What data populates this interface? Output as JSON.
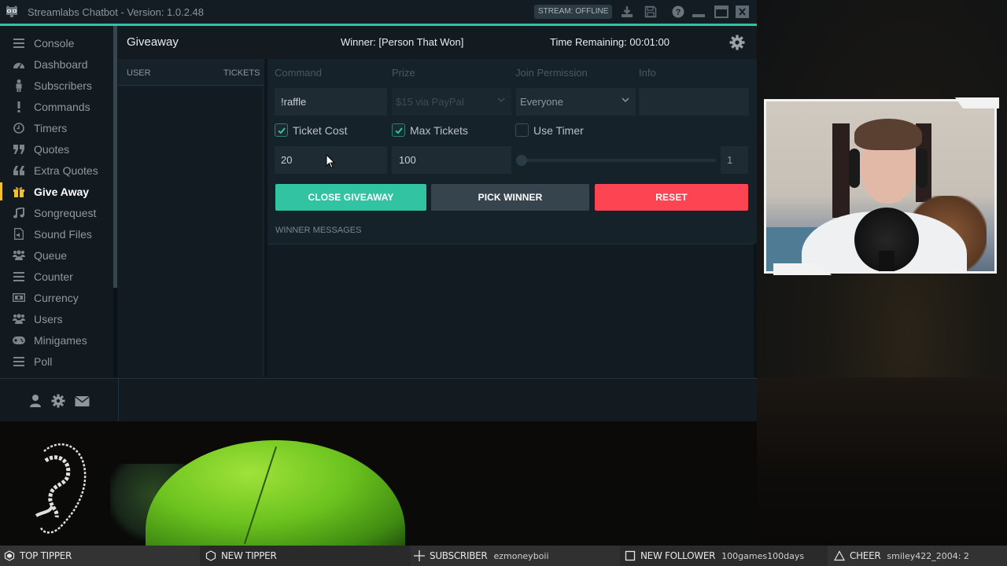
{
  "window": {
    "title": "Streamlabs Chatbot - Version: 1.0.2.48",
    "stream_status": "STREAM: OFFLINE",
    "accent_color": "#31c3a2"
  },
  "titlebar_buttons": [
    {
      "name": "download-icon"
    },
    {
      "name": "save-icon"
    },
    {
      "name": "help-icon"
    },
    {
      "name": "minimize-icon"
    },
    {
      "name": "maximize-icon"
    },
    {
      "name": "close-icon"
    }
  ],
  "sidebar": {
    "items": [
      {
        "label": "Console",
        "icon": "menu-lines-icon",
        "active": false
      },
      {
        "label": "Dashboard",
        "icon": "dashboard-gauge-icon",
        "active": false
      },
      {
        "label": "Subscribers",
        "icon": "person-icon",
        "active": false
      },
      {
        "label": "Commands",
        "icon": "exclamation-icon",
        "active": false
      },
      {
        "label": "Timers",
        "icon": "clock-icon",
        "active": false
      },
      {
        "label": "Quotes",
        "icon": "quote-close-icon",
        "active": false
      },
      {
        "label": "Extra Quotes",
        "icon": "quote-open-icon",
        "active": false
      },
      {
        "label": "Give Away",
        "icon": "gift-icon",
        "active": true
      },
      {
        "label": "Songrequest",
        "icon": "music-note-icon",
        "active": false
      },
      {
        "label": "Sound Files",
        "icon": "audio-file-icon",
        "active": false
      },
      {
        "label": "Queue",
        "icon": "users-group-icon",
        "active": false
      },
      {
        "label": "Counter",
        "icon": "menu-lines-icon",
        "active": false
      },
      {
        "label": "Currency",
        "icon": "money-icon",
        "active": false
      },
      {
        "label": "Users",
        "icon": "users-group-icon",
        "active": false
      },
      {
        "label": "Minigames",
        "icon": "gamepad-icon",
        "active": false
      },
      {
        "label": "Poll",
        "icon": "menu-lines-icon",
        "active": false
      }
    ],
    "active_color": "#f5c12a",
    "footer_icons": [
      "user-icon",
      "gear-icon",
      "envelope-icon"
    ]
  },
  "header": {
    "title": "Giveaway",
    "winner": "Winner: [Person That Won]",
    "time_remaining": "Time Remaining: 00:01:00"
  },
  "user_table": {
    "columns": [
      "USER",
      "TICKETS"
    ],
    "rows": []
  },
  "form": {
    "labels": {
      "command": "Command",
      "prize": "Prize",
      "join_permission": "Join Permission",
      "info": "Info"
    },
    "command_value": "!raffle",
    "prize_value": "$15 via PayPal",
    "join_permission_value": "Everyone",
    "info_value": "",
    "checkboxes": {
      "ticket_cost": {
        "label": "Ticket Cost",
        "checked": true
      },
      "max_tickets": {
        "label": "Max Tickets",
        "checked": true
      },
      "use_timer": {
        "label": "Use Timer",
        "checked": false
      }
    },
    "ticket_cost_value": "20",
    "max_tickets_value": "100",
    "timer_slider_value": 1,
    "timer_value_display": "1"
  },
  "buttons": {
    "close_giveaway": "CLOSE GIVEAWAY",
    "pick_winner": "PICK WINNER",
    "reset": "RESET",
    "colors": {
      "close": "#31c3a2",
      "pick": "#35444d",
      "reset": "#fc4452"
    }
  },
  "winner_messages": {
    "label": "WINNER MESSAGES",
    "messages": []
  },
  "ticker": [
    {
      "label": "TOP TIPPER",
      "value": "",
      "icon": "hexagon-filled-icon"
    },
    {
      "label": "NEW TIPPER",
      "value": "",
      "icon": "hexagon-outline-icon"
    },
    {
      "label": "SUBSCRIBER",
      "value": "ezmoneyboii",
      "icon": "plus-icon"
    },
    {
      "label": "NEW FOLLOWER",
      "value": "100games100days",
      "icon": "square-outline-icon"
    },
    {
      "label": "CHEER",
      "value": "smiley422_2004: 2",
      "icon": "triangle-outline-icon"
    }
  ]
}
